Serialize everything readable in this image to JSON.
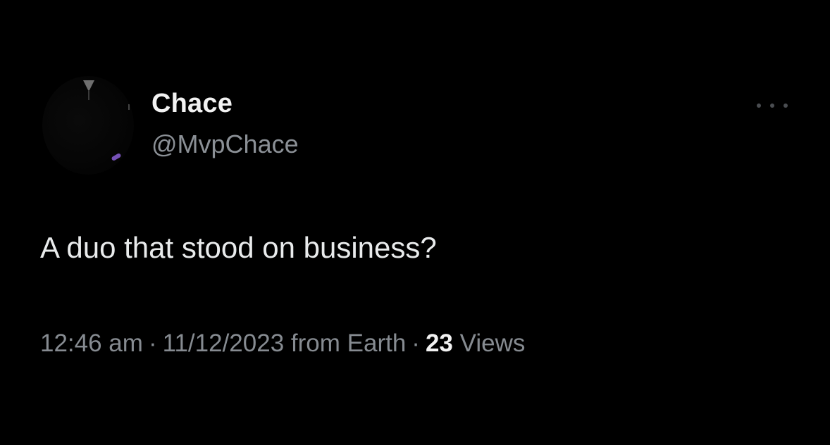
{
  "tweet": {
    "author": {
      "display_name": "Chace",
      "handle": "@MvpChace",
      "avatar_icon": "profile-photo"
    },
    "more_icon": "more-horizontal-icon",
    "text": "A duo that stood on business?",
    "meta": {
      "time": "12:46 am",
      "separator": "·",
      "date": "11/12/2023",
      "source": "from Earth",
      "views_count": "23",
      "views_label": "Views"
    }
  },
  "colors": {
    "background": "#000000",
    "primary_text": "#e9ebec",
    "secondary_text": "#868b91"
  }
}
